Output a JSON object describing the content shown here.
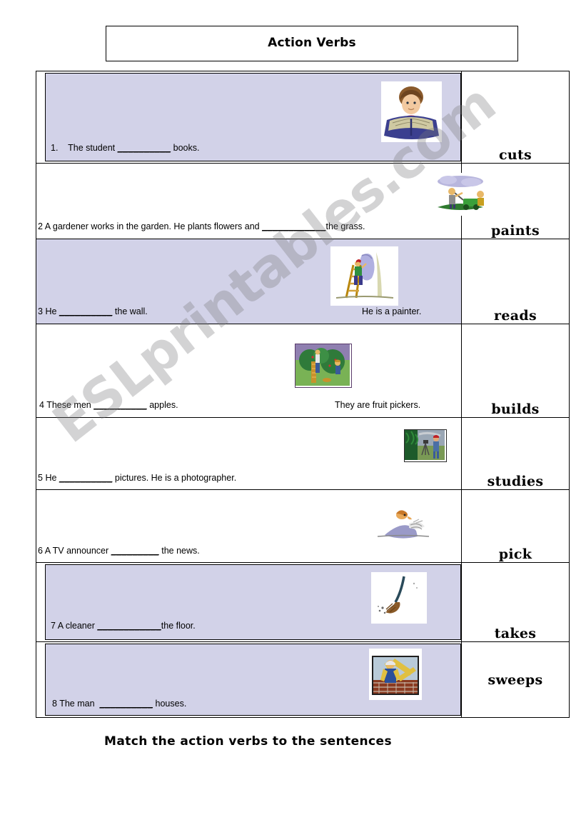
{
  "title": {
    "text": "Action Verbs"
  },
  "footer": {
    "instruction": "Match the action verbs to the sentences"
  },
  "watermark": {
    "text": "ESLprintables.com"
  },
  "colors": {
    "shade": "#d2d2e8",
    "border": "#000000",
    "page": "#ffffff",
    "watermark": "rgba(120,120,125,0.33)"
  },
  "rows": [
    {
      "number": "1.",
      "sentence_before": "The student",
      "blank": "__________",
      "sentence_after": "books.",
      "tail_note": "",
      "verb": "cuts",
      "shaded": true,
      "image": "student-reading-book-image"
    },
    {
      "number": "2",
      "sentence_before": "A gardener works in the garden. He plants flowers and",
      "blank": "____________",
      "sentence_after": "the grass.",
      "tail_note": "",
      "verb": "paints",
      "shaded": false,
      "image": "lawnmower-gardener-image"
    },
    {
      "number": "3",
      "sentence_before": "He",
      "blank": "__________",
      "sentence_after": "the wall.",
      "tail_note": "He is a painter.",
      "verb": "reads",
      "shaded": true,
      "image": "painter-on-ladder-image"
    },
    {
      "number": "4",
      "sentence_before": "These men",
      "blank": "__________",
      "sentence_after": "apples.",
      "tail_note": "They are fruit pickers.",
      "verb": "builds",
      "shaded": false,
      "image": "apple-pickers-orchard-image"
    },
    {
      "number": "5",
      "sentence_before": "He",
      "blank": "__________",
      "sentence_after": "pictures. He is a photographer.",
      "tail_note": "",
      "verb": "studies",
      "shaded": false,
      "image": "photographer-tripod-image"
    },
    {
      "number": "6",
      "sentence_before": "A TV announcer",
      "blank": "_________",
      "sentence_after": "the news.",
      "tail_note": "",
      "verb": "pick",
      "shaded": false,
      "image": "news-announcer-image"
    },
    {
      "number": "7",
      "sentence_before": "A cleaner",
      "blank": "____________",
      "sentence_after": "the floor.",
      "tail_note": "",
      "verb": "takes",
      "shaded": true,
      "image": "broom-sweeping-image"
    },
    {
      "number": "8",
      "sentence_before": "The man",
      "blank": "__________",
      "sentence_after": "houses.",
      "tail_note": "",
      "verb": "sweeps",
      "shaded": true,
      "image": "builder-construction-image"
    }
  ]
}
